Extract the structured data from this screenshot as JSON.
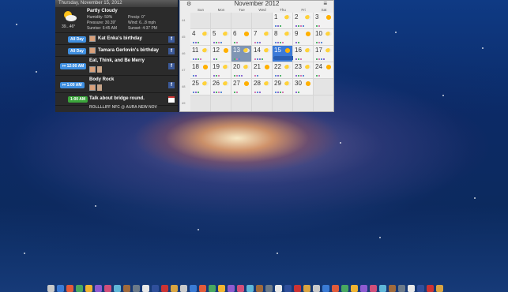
{
  "agenda": {
    "date_header": "Thursday, November 15, 2012",
    "weather": {
      "condition": "Partly Cloudy",
      "temp_range": "39...46°",
      "humidity": "Humidity: 59%",
      "pressure": "Pressure: 30.39\"",
      "sunrise": "Sunrise:   6:45 AM",
      "precip": "Precip:  0\"",
      "wind": "Wind:      6...8 mph",
      "sunset": "Sunset:  4:37 PM",
      "icon": "partly-cloudy-icon"
    },
    "events": [
      {
        "time": "All Day",
        "title": "Kat Enka's birthday",
        "icon": "facebook-icon"
      },
      {
        "time": "All Day",
        "title": "Tamara Gerlovin's birthday",
        "icon": "facebook-icon"
      },
      {
        "time": "↦ 12:00 AM",
        "title": "Eat, Think, and Be Merry",
        "icon": "facebook-icon"
      },
      {
        "time": "↦ 1:00 AM",
        "title": "Body Rock",
        "icon": "facebook-icon"
      },
      {
        "time": "1:00 AM",
        "title": "Talk about bridge round.",
        "icon": "calendar-icon"
      }
    ],
    "truncated_line": "ROLLLLIFF NFC @ AURA NEW NOV"
  },
  "calendar": {
    "month_title": "November 2012",
    "weekdays": [
      "Sun",
      "Mon",
      "Tue",
      "Wed",
      "Thu",
      "Fri",
      "Sat"
    ],
    "week_numbers": [
      "44",
      "45",
      "46",
      "47",
      "48",
      "49"
    ],
    "weeks": [
      [
        "",
        "",
        "",
        "",
        "1",
        "2",
        "3"
      ],
      [
        "4",
        "5",
        "6",
        "7",
        "8",
        "9",
        "10"
      ],
      [
        "11",
        "12",
        "13",
        "14",
        "15",
        "16",
        "17"
      ],
      [
        "18",
        "19",
        "20",
        "21",
        "22",
        "23",
        "24"
      ],
      [
        "25",
        "26",
        "27",
        "28",
        "29",
        "30",
        ""
      ],
      [
        "",
        "",
        "",
        "",
        "",
        "",
        ""
      ]
    ],
    "selected_day": "13",
    "today": "15"
  },
  "colors": {
    "accent_blue": "#3f8fe0",
    "accent_green": "#3ba53b",
    "facebook": "#3b5998",
    "today_highlight": "#3b7ad8",
    "selected_highlight": "#7f95b4"
  }
}
